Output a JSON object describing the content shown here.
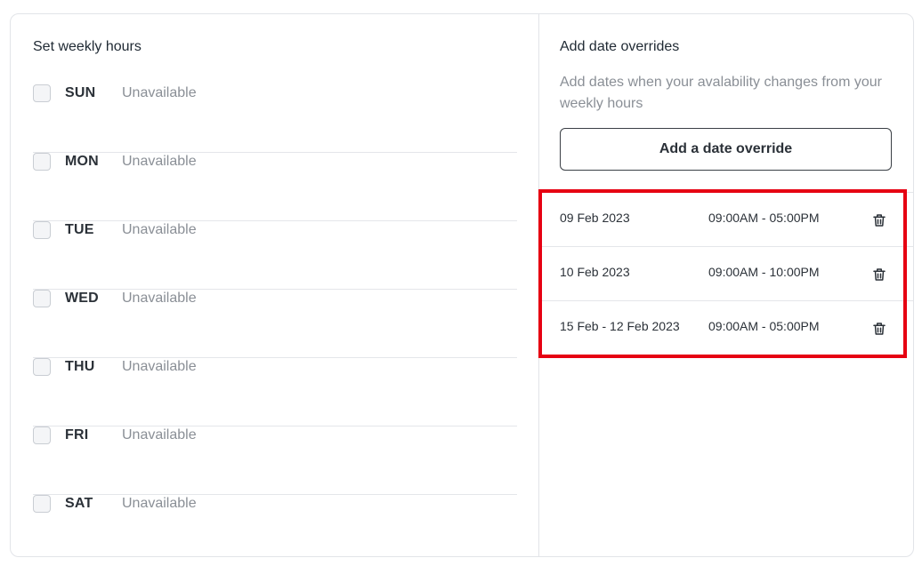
{
  "weekly": {
    "title": "Set weekly hours",
    "days": [
      {
        "name": "SUN",
        "status": "Unavailable"
      },
      {
        "name": "MON",
        "status": "Unavailable"
      },
      {
        "name": "TUE",
        "status": "Unavailable"
      },
      {
        "name": "WED",
        "status": "Unavailable"
      },
      {
        "name": "THU",
        "status": "Unavailable"
      },
      {
        "name": "FRI",
        "status": "Unavailable"
      },
      {
        "name": "SAT",
        "status": "Unavailable"
      }
    ]
  },
  "overrides": {
    "title": "Add date overrides",
    "description": "Add dates when your avalability changes from your weekly hours",
    "add_button_label": "Add a date override",
    "items": [
      {
        "date": "09 Feb 2023",
        "time": "09:00AM - 05:00PM",
        "icon": "trash-icon"
      },
      {
        "date": "10 Feb 2023",
        "time": "09:00AM - 10:00PM",
        "icon": "trash-icon"
      },
      {
        "date": "15 Feb - 12 Feb 2023",
        "time": "09:00AM - 05:00PM",
        "icon": "trash-icon"
      }
    ]
  },
  "colors": {
    "highlight": "#e60012",
    "muted_text": "#8a8f96",
    "border": "#e2e4e8"
  }
}
